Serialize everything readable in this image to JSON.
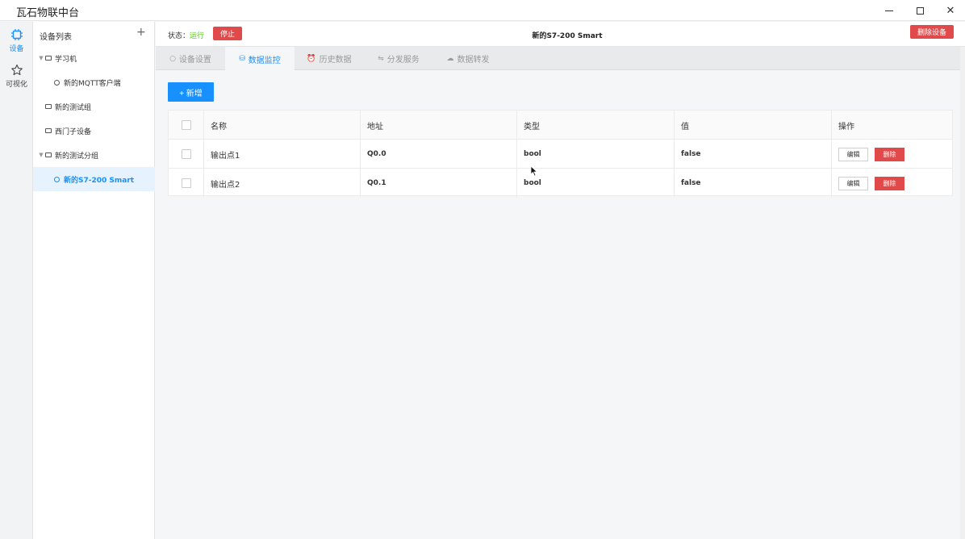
{
  "window": {
    "title": "瓦石物联中台"
  },
  "rail": {
    "device_label": "设备",
    "visual_label": "可视化",
    "accent": "#1890ff"
  },
  "tree": {
    "title": "设备列表",
    "add": "+",
    "nodes": [
      {
        "label": "学习机",
        "kind": "folder",
        "expanded": true
      },
      {
        "label": "新的MQTT客户端",
        "kind": "device"
      },
      {
        "label": "新的测试组",
        "kind": "folder"
      },
      {
        "label": "西门子设备",
        "kind": "folder"
      },
      {
        "label": "新的测试分组",
        "kind": "folder",
        "expanded": true
      },
      {
        "label": "新的S7-200 Smart",
        "kind": "device",
        "selected": true
      }
    ]
  },
  "topbar": {
    "status_prefix": "状态：",
    "status_value": "运行",
    "stop_label": "停止",
    "device_name": "新的S7-200 Smart",
    "delete_device_label": "删除设备"
  },
  "tabs": [
    {
      "label": "设备设置",
      "icon": "gear-icon",
      "glyph": "○"
    },
    {
      "label": "数据监控",
      "icon": "database-icon",
      "glyph": "⛁",
      "active": true
    },
    {
      "label": "历史数据",
      "icon": "alarm-clock-icon",
      "glyph": "⏰"
    },
    {
      "label": "分发服务",
      "icon": "swap-icon",
      "glyph": "⇋"
    },
    {
      "label": "数据转发",
      "icon": "cloud-icon",
      "glyph": "☁"
    }
  ],
  "toolbar": {
    "add_label": "+ 新增"
  },
  "table": {
    "columns": [
      "名称",
      "地址",
      "类型",
      "值",
      "操作"
    ],
    "rows": [
      {
        "name": "输出点1",
        "address": "Q0.0",
        "type": "bool",
        "value": "false"
      },
      {
        "name": "输出点2",
        "address": "Q0.1",
        "type": "bool",
        "value": "false"
      }
    ],
    "edit_label": "编辑",
    "delete_label": "删除"
  },
  "colors": {
    "danger": "#e04a4a",
    "success": "#52c41a",
    "primary": "#1890ff"
  }
}
